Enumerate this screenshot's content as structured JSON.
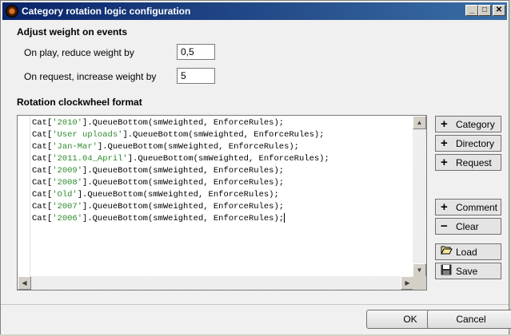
{
  "window": {
    "title": "Category rotation logic configuration"
  },
  "titlebar_buttons": {
    "minimize": "_",
    "maximize": "□",
    "close": "✕"
  },
  "weights": {
    "section_title": "Adjust weight on events",
    "on_play_label": "On play, reduce weight by",
    "on_play_value": "0,5",
    "on_request_label": "On request, increase weight by",
    "on_request_value": "5"
  },
  "clockwheel": {
    "section_title": "Rotation clockwheel format",
    "lines": [
      {
        "pre": "Cat[",
        "str": "'2010'",
        "post": "].QueueBottom(smWeighted, EnforceRules);"
      },
      {
        "pre": "Cat[",
        "str": "'User uploads'",
        "post": "].QueueBottom(smWeighted, EnforceRules);"
      },
      {
        "pre": "Cat[",
        "str": "'Jan-Mar'",
        "post": "].QueueBottom(smWeighted, EnforceRules);"
      },
      {
        "pre": "Cat[",
        "str": "'2011.04_April'",
        "post": "].QueueBottom(smWeighted, EnforceRules);"
      },
      {
        "pre": "Cat[",
        "str": "'2009'",
        "post": "].QueueBottom(smWeighted, EnforceRules);"
      },
      {
        "pre": "Cat[",
        "str": "'2008'",
        "post": "].QueueBottom(smWeighted, EnforceRules);"
      },
      {
        "pre": "Cat[",
        "str": "'Old'",
        "post": "].QueueBottom(smWeighted, EnforceRules);"
      },
      {
        "pre": "Cat[",
        "str": "'2007'",
        "post": "].QueueBottom(smWeighted, EnforceRules);"
      },
      {
        "pre": "Cat[",
        "str": "'2006'",
        "post": "].QueueBottom(smWeighted, EnforceRules);"
      }
    ]
  },
  "side_buttons": {
    "category": "Category",
    "directory": "Directory",
    "request": "Request",
    "comment": "Comment",
    "clear": "Clear",
    "load": "Load",
    "save": "Save"
  },
  "footer": {
    "ok": "OK",
    "cancel": "Cancel"
  },
  "colors": {
    "string_literal": "#2e8b2e",
    "titlebar_start": "#0a246a",
    "titlebar_end": "#3a6ea5"
  }
}
